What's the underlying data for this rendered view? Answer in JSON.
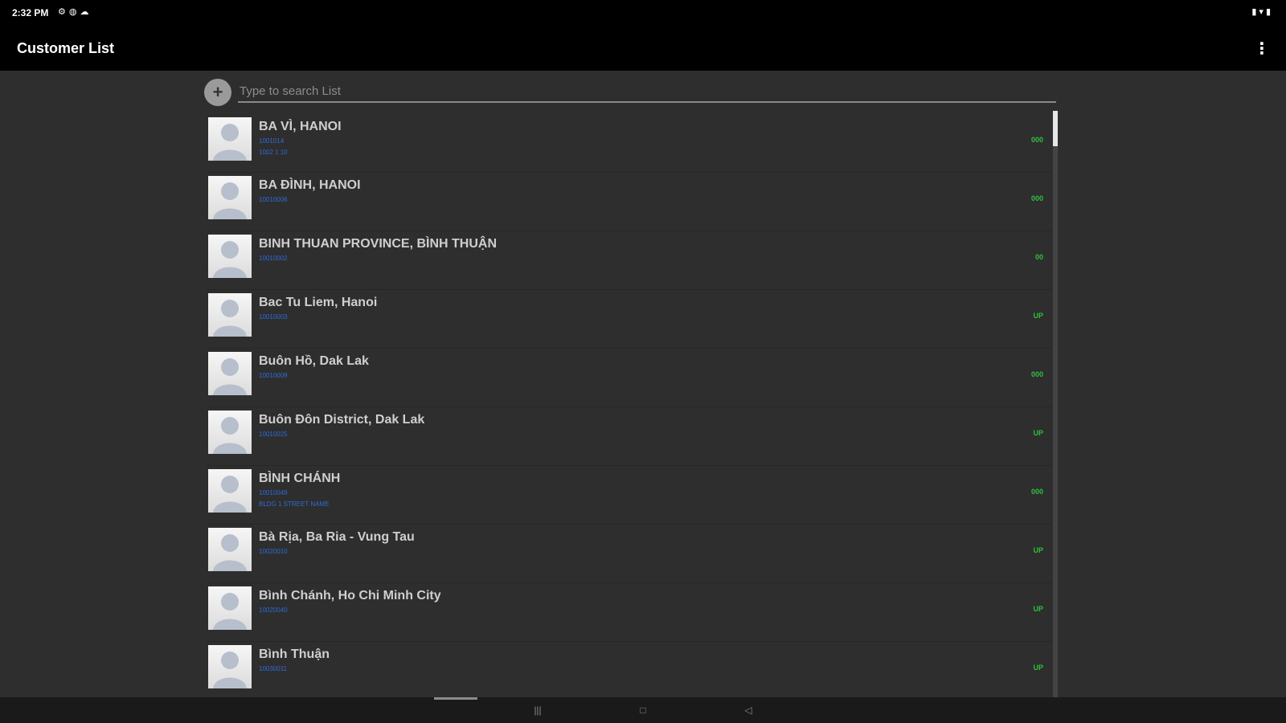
{
  "status_bar": {
    "time": "2:32 PM",
    "left_icons": [
      "settings-icon",
      "shield-icon",
      "cloud-icon"
    ],
    "right_icons": [
      "signal-icon",
      "wifi-icon",
      "battery-icon"
    ]
  },
  "app_bar": {
    "title": "Customer List",
    "menu_icon": "more-vert-icon"
  },
  "search": {
    "placeholder": "Type to search List",
    "value": "",
    "add_icon": "plus-icon"
  },
  "customers": [
    {
      "name": "BA VÌ, HANOI",
      "sub1": "1001014",
      "sub2": "1002 1 10",
      "status": "000"
    },
    {
      "name": "BA ĐÌNH, HANOI",
      "sub1": "10010006",
      "sub2": "",
      "status": "000"
    },
    {
      "name": "BINH THUAN PROVINCE, BÌNH THUẬN",
      "sub1": "10010002",
      "sub2": "",
      "status": "00"
    },
    {
      "name": "Bac Tu Liem, Hanoi",
      "sub1": "10010003",
      "sub2": "",
      "status": "UP"
    },
    {
      "name": "Buôn Hồ, Dak Lak",
      "sub1": "10010009",
      "sub2": "",
      "status": "000"
    },
    {
      "name": "Buôn Đôn District, Dak Lak",
      "sub1": "10010025",
      "sub2": "",
      "status": "UP"
    },
    {
      "name": "BÌNH CHÁNH",
      "sub1": "10010049",
      "sub2": "BLDG 1 STREET NAME",
      "status": "000"
    },
    {
      "name": "Bà Rịa, Ba Ria - Vung Tau",
      "sub1": "10020010",
      "sub2": "",
      "status": "UP"
    },
    {
      "name": "Bình Chánh, Ho Chi Minh City",
      "sub1": "10020040",
      "sub2": "",
      "status": "UP"
    },
    {
      "name": "Bình Thuận",
      "sub1": "10030011",
      "sub2": "",
      "status": "UP"
    }
  ],
  "nav_bar": {
    "buttons": [
      "recents-icon",
      "home-icon",
      "back-icon"
    ]
  }
}
